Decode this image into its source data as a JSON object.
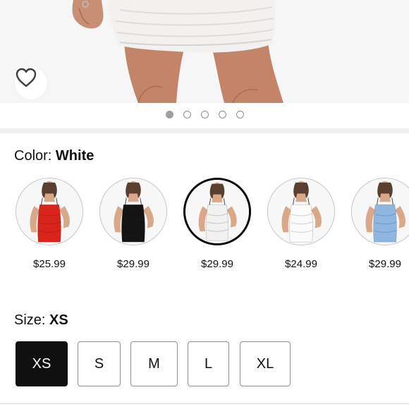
{
  "pager": {
    "count": 5,
    "active_index": 0
  },
  "color": {
    "label": "Color:",
    "selected_value": "White",
    "swatches": [
      {
        "name": "red",
        "dress_color": "#d9241b",
        "price": "$25.99",
        "selected": false
      },
      {
        "name": "black",
        "dress_color": "#141414",
        "price": "$29.99",
        "selected": false
      },
      {
        "name": "white",
        "dress_color": "#f1f1f1",
        "price": "$29.99",
        "selected": true
      },
      {
        "name": "white-2",
        "dress_color": "#fbfbfb",
        "price": "$24.99",
        "selected": false
      },
      {
        "name": "light-blue",
        "dress_color": "#8fb6e0",
        "price": "$29.99",
        "selected": false
      }
    ]
  },
  "size": {
    "label": "Size:",
    "selected_value": "XS",
    "options": [
      "XS",
      "S",
      "M",
      "L",
      "XL"
    ]
  },
  "icons": {
    "favorite": "heart-outline-icon"
  }
}
